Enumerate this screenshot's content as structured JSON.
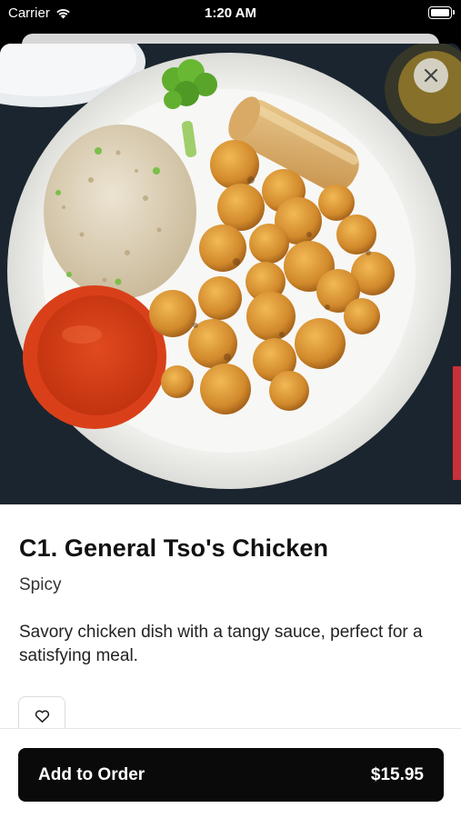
{
  "status_bar": {
    "carrier": "Carrier",
    "time": "1:20 AM",
    "wifi_icon": "wifi-icon",
    "battery_icon": "battery-icon"
  },
  "item": {
    "title": "C1. General Tso's Chicken",
    "tag": "Spicy",
    "description": "Savory chicken dish with a tangy sauce, perfect for a satisfying meal.",
    "image": "general-tsos-chicken-photo"
  },
  "actions": {
    "close_icon": "close-icon",
    "favorite_icon": "heart-icon",
    "add_to_order_label": "Add to Order",
    "price": "$15.95"
  },
  "colors": {
    "button_bg": "#0a0a0a",
    "sauce_cup": "#e2431f",
    "chicken": "#d79a3c"
  }
}
